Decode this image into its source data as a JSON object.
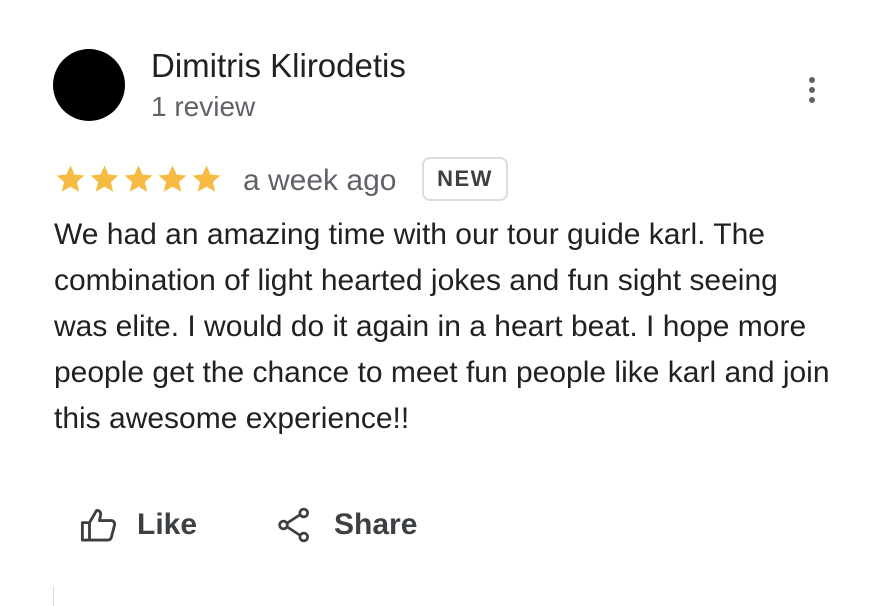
{
  "review": {
    "author_name": "Dimitris Klirodetis",
    "author_review_count": "1 review",
    "rating": 5,
    "rating_max": 5,
    "timestamp": "a week ago",
    "badge": "NEW",
    "text": "We had an amazing time with our tour guide karl. The combination of light hearted jokes and fun sight seeing was elite. I would do it again in a heart beat. I hope more people get the chance to meet fun people like karl and join this awesome experience!!"
  },
  "actions": {
    "like_label": "Like",
    "share_label": "Share"
  },
  "icons": {
    "more": "more-vert-icon",
    "star": "star-icon",
    "like": "thumb-up-icon",
    "share": "share-icon"
  },
  "colors": {
    "star": "#F6BB42",
    "text_primary": "#202124",
    "text_secondary": "#5F6368",
    "avatar": "#000000",
    "badge_border": "#DADCE0"
  }
}
